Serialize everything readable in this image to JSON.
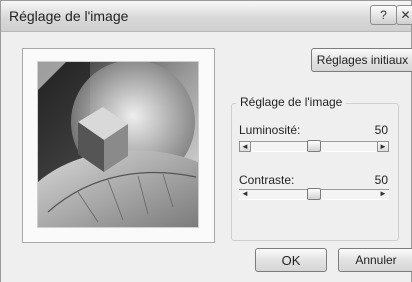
{
  "window": {
    "title": "Réglage de l'image",
    "help_label": "?",
    "close_label": "✕"
  },
  "buttons": {
    "reset_label": "Réglages initiaux",
    "ok_label": "OK",
    "cancel_label": "Annuler"
  },
  "adjust_group": {
    "legend": "Réglage de l'image",
    "brightness": {
      "label": "Luminosité:",
      "value": "50",
      "level": 0.5
    },
    "contrast": {
      "label": "Contraste:",
      "value": "50",
      "level": 0.5
    }
  },
  "arrows": {
    "left": "◄",
    "right": "►"
  },
  "colors": {
    "window_bg": "#efefef",
    "button_border": "#7c7c7c"
  }
}
